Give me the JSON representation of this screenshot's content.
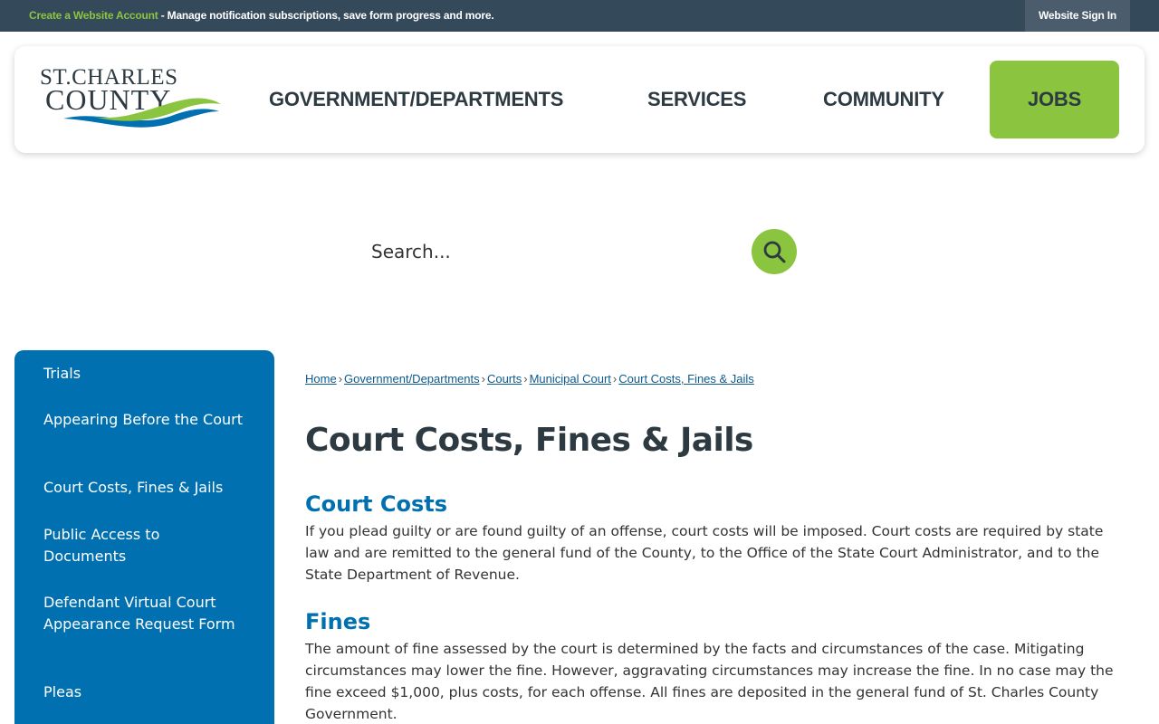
{
  "topbar": {
    "create_account_link": "Create a Website Account",
    "message": " - Manage notification subscriptions, save form progress and more.",
    "sign_in": "Website Sign In"
  },
  "logo": {
    "line1": "ST. CHARLES",
    "line2": "COUNTY",
    "colors": {
      "text": "#2d3a42",
      "wave_blue": "#0070b0",
      "wave_green": "#8bc53f"
    }
  },
  "nav": {
    "items": [
      "GOVERNMENT/DEPARTMENTS",
      "SERVICES",
      "COMMUNITY",
      "JOBS"
    ]
  },
  "search": {
    "placeholder": "Search...",
    "icon": "search-icon"
  },
  "sidebar": {
    "items": [
      "Trials",
      "Appearing Before the Court",
      "Court Costs, Fines & Jails",
      "Public Access to Documents",
      "Defendant Virtual Court Appearance Request Form",
      "Pleas"
    ]
  },
  "breadcrumb": {
    "items": [
      "Home",
      "Government/Departments",
      "Courts",
      "Municipal Court",
      "Court Costs, Fines & Jails"
    ],
    "separator": "›"
  },
  "main": {
    "title": "Court Costs, Fines & Jails",
    "sections": [
      {
        "heading": "Court Costs",
        "body": "If you plead guilty or are found guilty of an offense, court costs will be imposed. Court costs are required by state law and are remitted to the general fund of the County, to the Office of the State Court Administrator, and to the State Department of Revenue."
      },
      {
        "heading": "Fines",
        "body": "The amount of fine assessed by the court is determined by the facts and circumstances of the case. Mitigating circumstances may lower the fine. However, aggravating circumstances may increase the fine. In no case may the fine exceed $1,000, plus costs, for each offense. All fines are deposited in the general fund of St. Charles County Government."
      }
    ]
  },
  "colors": {
    "topbar": "#34495a",
    "accent_green": "#8bc53f",
    "sidebar_blue": "#0070b0",
    "heading_dark": "#2d3a42"
  }
}
